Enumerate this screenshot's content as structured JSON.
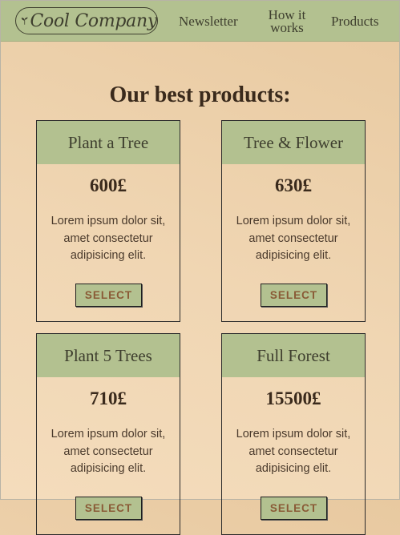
{
  "nav": {
    "brand": "Cool Company",
    "links": [
      "Newsletter",
      "How it works",
      "Products"
    ]
  },
  "heading": "Our best products:",
  "products": [
    {
      "name": "Plant a Tree",
      "price": "600£",
      "description": "Lorem ipsum dolor sit, amet consectetur adipisicing elit.",
      "button": "SELECT"
    },
    {
      "name": "Tree & Flower",
      "price": "630£",
      "description": "Lorem ipsum dolor sit, amet consectetur adipisicing elit.",
      "button": "SELECT"
    },
    {
      "name": "Plant 5 Trees",
      "price": "710£",
      "description": "Lorem ipsum dolor sit, amet consectetur adipisicing elit.",
      "button": "SELECT"
    },
    {
      "name": "Full Forest",
      "price": "15500£",
      "description": "Lorem ipsum dolor sit, amet consectetur adipisicing elit.",
      "button": "SELECT"
    }
  ],
  "colors": {
    "accent": "#b3c190",
    "background": "#efd3ae",
    "text": "#3a2a1c"
  }
}
